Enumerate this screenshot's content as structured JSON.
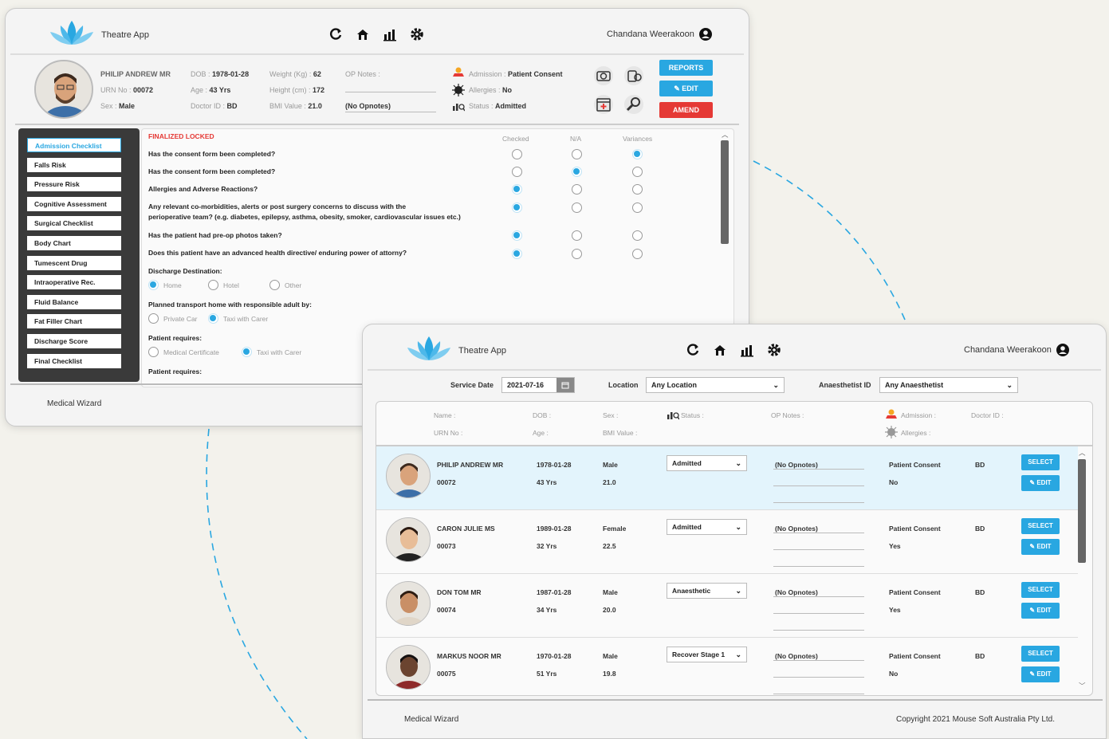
{
  "window1": {
    "app_title": "Theatre App",
    "user_name": "Chandana Weerakoon",
    "patient": {
      "name": "PHILIP ANDREW MR",
      "urn_label": "URN No :",
      "urn": "00072",
      "sex_label": "Sex :",
      "sex": "Male",
      "dob_label": "DOB :",
      "dob": "1978-01-28",
      "age_label": "Age :",
      "age": "43 Yrs",
      "doctor_label": "Doctor ID :",
      "doctor": "BD",
      "weight_label": "Weight (Kg) :",
      "weight": "62",
      "height_label": "Height (cm) :",
      "height": "172",
      "bmi_label": "BMI Value :",
      "bmi": "21.0",
      "op_notes_label": "OP Notes :",
      "op_notes": "(No Opnotes)",
      "admission_label": "Admission :",
      "admission": "Patient Consent",
      "allergies_label": "Allergies :",
      "allergies": "No",
      "status_label": "Status :",
      "status": "Admitted"
    },
    "buttons": {
      "reports": "REPORTS",
      "edit": "EDIT",
      "amend": "AMEND"
    },
    "sidebar": [
      "Admission Checklist",
      "Falls Risk",
      "Pressure Risk",
      "Cognitive Assessment",
      "Surgical Checklist",
      "Body Chart",
      "Tumescent Drug",
      "Intraoperative Rec.",
      "Fluid Balance",
      "Fat Filler Chart",
      "Discharge Score",
      "Final Checklist"
    ],
    "finalized": "FINALIZED LOCKED",
    "col_checked": "Checked",
    "col_na": "N/A",
    "col_variances": "Variances",
    "questions": [
      "Has the consent form been completed?",
      "Has the consent form been completed?",
      "Allergies and Adverse Reactions?",
      "Any relevant co-morbidities, alerts or post surgery concerns to discuss with the",
      "perioperative team? (e.g. diabetes, epilepsy, asthma, obesity, smoker, cardiovascular issues etc.)",
      "Has the patient had pre-op photos taken?",
      "Does this patient have an advanced health directive/ enduring power of attorny?"
    ],
    "discharge_label": "Discharge Destination:",
    "discharge_opts": [
      "Home",
      "Hotel",
      "Other"
    ],
    "transport_label": "Planned transport home with responsible adult by:",
    "transport_opts": [
      "Private Car",
      "Taxi with Carer"
    ],
    "requires_label": "Patient requires:",
    "requires_opts": [
      "Medical Certificate",
      "Taxi with Carer"
    ],
    "requires_label2": "Patient requires:",
    "footer": "Medical Wizard"
  },
  "window2": {
    "app_title": "Theatre App",
    "user_name": "Chandana Weerakoon",
    "filters": {
      "service_date_label": "Service Date",
      "service_date": "2021-07-16",
      "location_label": "Location",
      "location": "Any Location",
      "anaesthetist_label": "Anaesthetist ID",
      "anaesthetist": "Any Anaesthetist"
    },
    "headers": {
      "name": "Name :",
      "urn": "URN No :",
      "dob": "DOB :",
      "age": "Age :",
      "sex": "Sex :",
      "bmi": "BMI Value :",
      "status": "Status :",
      "op_notes": "OP Notes :",
      "admission": "Admission :",
      "allergies": "Allergies :",
      "doctor": "Doctor ID :"
    },
    "rows": [
      {
        "name": "PHILIP ANDREW MR",
        "urn": "00072",
        "dob": "1978-01-28",
        "age": "43 Yrs",
        "sex": "Male",
        "bmi": "21.0",
        "status": "Admitted",
        "notes": "(No Opnotes)",
        "admission": "Patient Consent",
        "allergies": "No",
        "doctor": "BD"
      },
      {
        "name": "CARON JULIE MS",
        "urn": "00073",
        "dob": "1989-01-28",
        "age": "32 Yrs",
        "sex": "Female",
        "bmi": "22.5",
        "status": "Admitted",
        "notes": "(No Opnotes)",
        "admission": "Patient Consent",
        "allergies": "Yes",
        "doctor": "BD"
      },
      {
        "name": "DON TOM MR",
        "urn": "00074",
        "dob": "1987-01-28",
        "age": "34 Yrs",
        "sex": "Male",
        "bmi": "20.0",
        "status": "Anaesthetic",
        "notes": "(No Opnotes)",
        "admission": "Patient Consent",
        "allergies": "Yes",
        "doctor": "BD"
      },
      {
        "name": "MARKUS NOOR MR",
        "urn": "00075",
        "dob": "1970-01-28",
        "age": "51 Yrs",
        "sex": "Male",
        "bmi": "19.8",
        "status": "Recover Stage 1",
        "notes": "(No Opnotes)",
        "admission": "Patient Consent",
        "allergies": "No",
        "doctor": "BD"
      }
    ],
    "select_label": "SELECT",
    "edit_label": "EDIT",
    "footer": "Medical Wizard",
    "copyright": "Copyright 2021 Mouse Soft Australia Pty Ltd."
  },
  "colors": {
    "accent": "#29a7e1",
    "danger": "#e53935",
    "selected_row": "#e3f4fc"
  }
}
